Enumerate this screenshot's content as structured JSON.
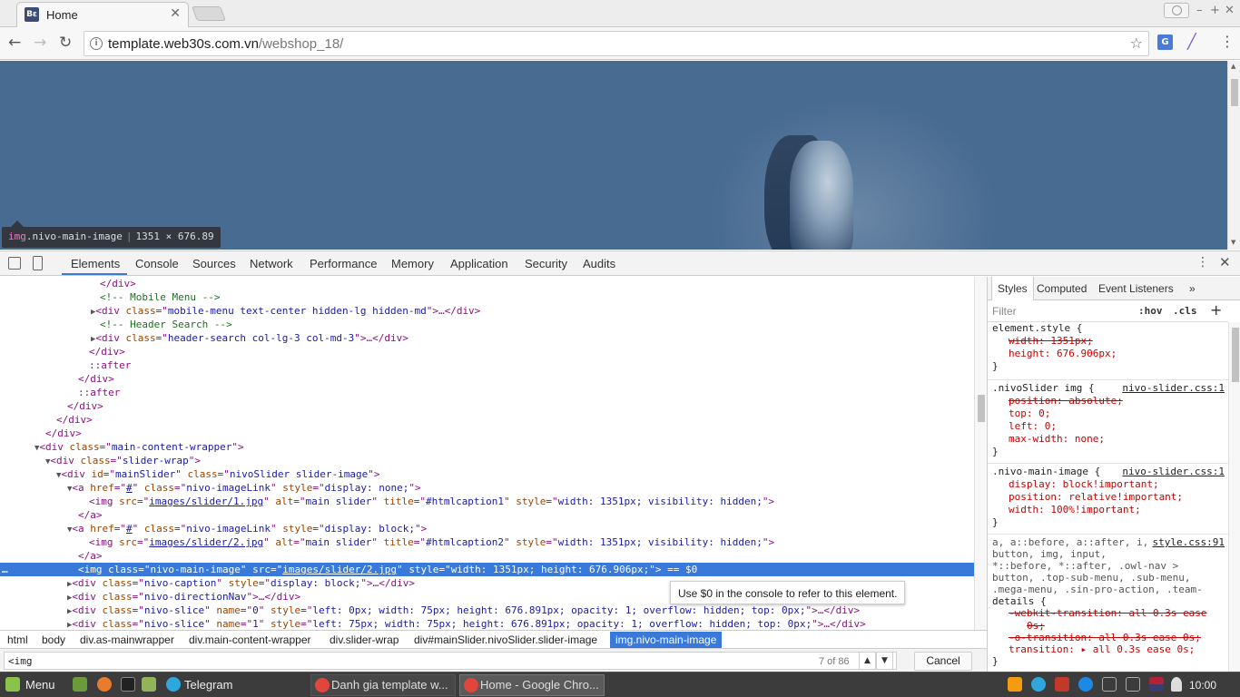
{
  "browser": {
    "tab_title": "Home",
    "favicon_text": "Bε",
    "url_host": "template.web30s.com.vn",
    "url_path": "/webshop_18/"
  },
  "page_tooltip": {
    "tag": "img",
    "cls": ".nivo-main-image",
    "size": "1351 × 676.89"
  },
  "devtools": {
    "tabs": [
      "Elements",
      "Console",
      "Sources",
      "Network",
      "Performance",
      "Memory",
      "Application",
      "Security",
      "Audits"
    ],
    "active_tab": "Elements",
    "hint": "Use $0 in the console to refer to this element.",
    "breadcrumbs": [
      "html",
      "body",
      "div.as-mainwrapper",
      "div.main-content-wrapper",
      "div.slider-wrap",
      "div#mainSlider.nivoSlider.slider-image",
      "img.nivo-main-image"
    ],
    "search": {
      "value": "<img",
      "match_count": "7 of 86",
      "cancel_label": "Cancel"
    },
    "styles_tabs": [
      "Styles",
      "Computed",
      "Event Listeners"
    ],
    "filter_placeholder": "Filter",
    "filter_hov": ":hov",
    "filter_cls": ".cls",
    "rules": {
      "r1_selector": "element.style {",
      "r1_p1": "width: 1351px;",
      "r1_p2": "height: 676.906px;",
      "r2_selector": ".nivoSlider img {",
      "r2_src": "nivo-slider.css:1",
      "r2_p1": "position: absolute;",
      "r2_p2": "top: 0;",
      "r2_p3": "left: 0;",
      "r2_p4": "max-width: none;",
      "r3_selector": ".nivo-main-image {",
      "r3_src": "nivo-slider.css:1",
      "r3_p1": "display: block!important;",
      "r3_p2": "position: relative!important;",
      "r3_p3": "width: 100%!important;",
      "r4_src": "style.css:91",
      "r4_sel1": "a, a::before, a::after, i,",
      "r4_sel2": "button, img, input,",
      "r4_sel3": "*::before, *::after, .owl-nav >",
      "r4_sel4": "button, .top-sub-menu, .sub-menu,",
      "r4_sel5": ".mega-menu, .sin-pro-action, .team-",
      "r4_sel6": "details {",
      "r4_p1": "-webkit-transition: all 0.3s",
      "r4_p1b": "ease",
      "r4_p1c": "0s;",
      "r4_p2": "-o-transition: all 0.3s ease 0s;",
      "r4_p3": "transition: ▸ all 0.3s",
      "r4_p3b": "ease 0s;",
      "close": "}"
    }
  },
  "dom": {
    "l1": "</div>",
    "l2": "<!-- Mobile Menu -->",
    "l3a": "<div ",
    "l3b": "class",
    "l3c": "=\"",
    "l3d": "mobile-menu text-center hidden-lg hidden-md",
    "l3e": "\">…</div>",
    "l4": "<!-- Header Search -->",
    "l5d": "header-search col-lg-3 col-md-3",
    "l6": "</div>",
    "l7": "::after",
    "l8": "</div>",
    "l9": "::after",
    "l10": "</div>",
    "l11": "</div>",
    "l12": "</div>",
    "l13d": "main-content-wrapper",
    "l14d": "slider-wrap",
    "l15id": "mainSlider",
    "l15d": "nivoSlider slider-image",
    "l16href": "#",
    "l16d": "nivo-imageLink",
    "l16s": "display: none;",
    "l17src": "images/slider/1.jpg",
    "l17alt": "main slider",
    "l17title": "#htmlcaption1",
    "l17s": "width: 1351px; visibility: hidden;",
    "l18": "</a>",
    "l19s": "display: block;",
    "l20src": "images/slider/2.jpg",
    "l20title": "#htmlcaption2",
    "l21": "</a>",
    "l22cls": "nivo-main-image",
    "l22src": "images/slider/2.jpg",
    "l22s": "width: 1351px; height: 676.906px;",
    "l22end": " == $0",
    "l23d": "nivo-caption",
    "l23s": "display: block;",
    "l24d": "nivo-directionNav",
    "l25d": "nivo-slice",
    "l25n": "0",
    "l25s": "left: 0px; width: 75px; height: 676.891px; opacity: 1; overflow: hidden; top: 0px;",
    "l26n": "1",
    "l26s": "left: 75px; width: 75px; height: 676.891px; opacity: 1; overflow: hidden; top: 0px;"
  },
  "taskbar": {
    "menu": "Menu",
    "telegram": "Telegram",
    "win1": "Danh gia template w...",
    "win2": "Home - Google Chro...",
    "clock": "10:00"
  }
}
